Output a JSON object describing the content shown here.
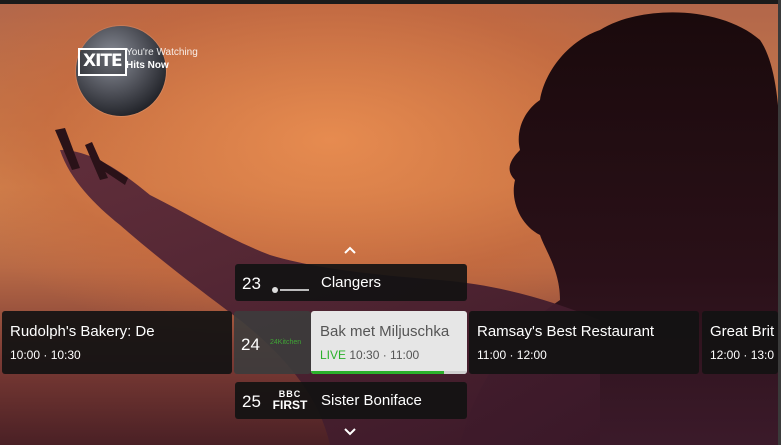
{
  "now_watching": {
    "logo_text": "XITE",
    "label": "You're Watching",
    "channel": "Hits Now"
  },
  "guide": {
    "up_icon": "chevron-up-icon",
    "down_icon": "chevron-down-icon",
    "prev_channel": {
      "number": "23",
      "logo_icon": "channel-logo-icon",
      "title": "Clangers"
    },
    "current_channel": {
      "number": "24",
      "logo_text": "24Kitchen",
      "logo_color": "#3fa535",
      "previous_program": {
        "title": "Rudolph's Bakery: De",
        "time": "10:00 · 10:30"
      },
      "current_program": {
        "title": "Bak met Miljuschka",
        "live_label": "LIVE",
        "time": "10:30 · 11:00",
        "progress": 0.85,
        "live_color": "#2bb12b"
      },
      "next_programs": [
        {
          "title": "Ramsay's Best Restaurant",
          "time": "11:00 · 12:00"
        },
        {
          "title": "Great Brit",
          "time": "12:00 · 13:0"
        }
      ]
    },
    "next_channel": {
      "number": "25",
      "logo_line1": "BBC",
      "logo_line2": "FIRST",
      "title": "Sister Boniface"
    }
  }
}
